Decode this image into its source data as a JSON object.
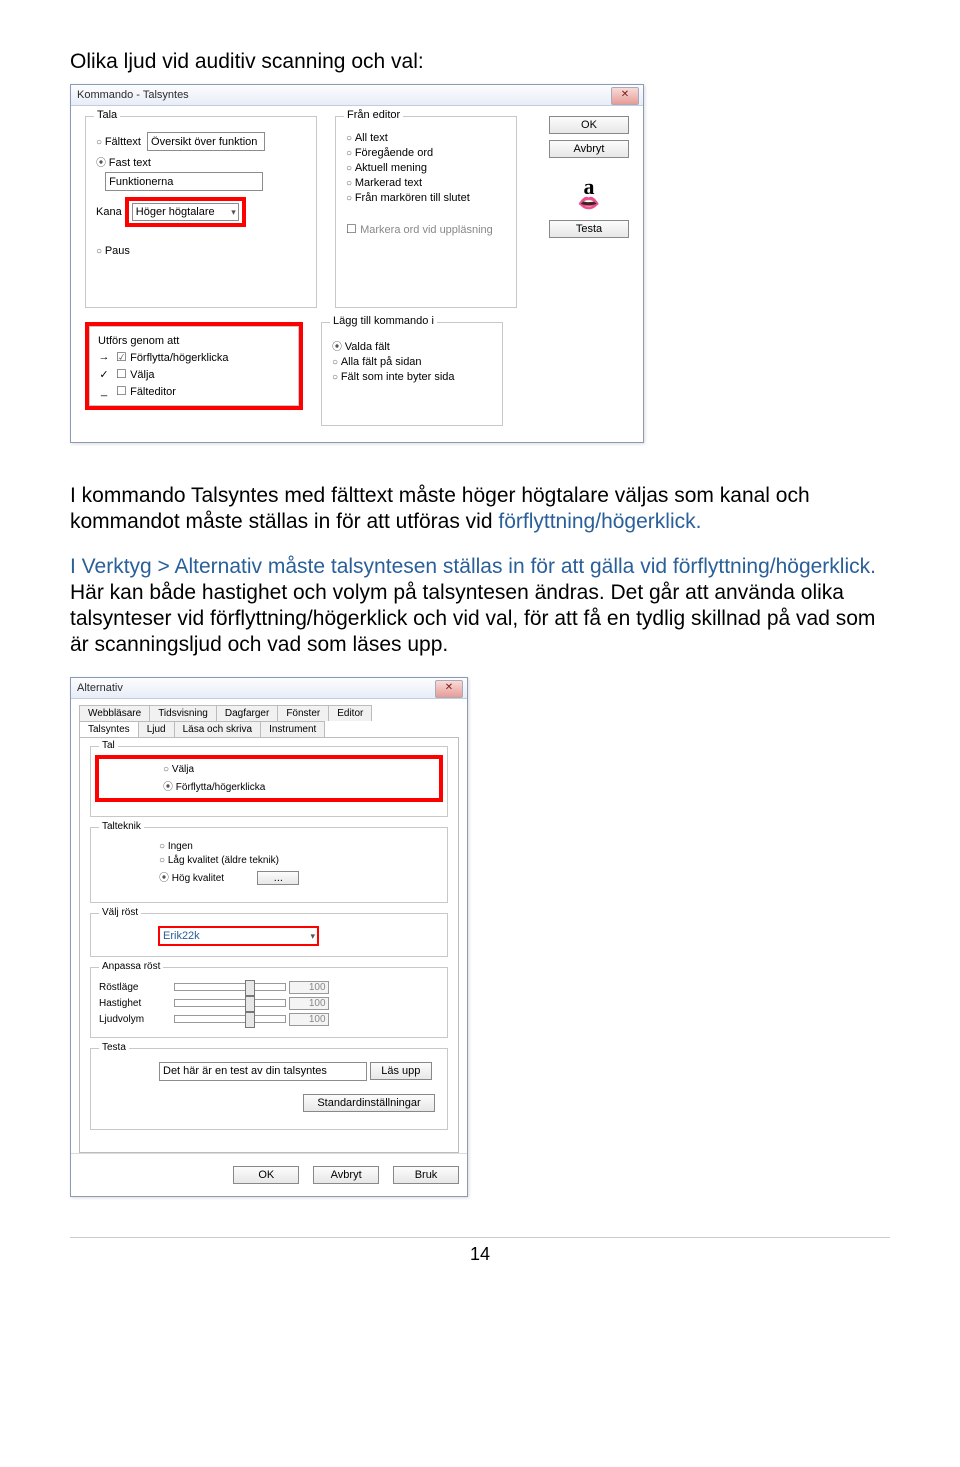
{
  "heading": "Olika ljud vid auditiv scanning och val:",
  "dlg1": {
    "title": "Kommando - Talsyntes",
    "ok": "OK",
    "avbryt": "Avbryt",
    "testa": "Testa",
    "tala": {
      "legend": "Tala",
      "falttext": "Fälttext",
      "oversikt": "Översikt över funktion",
      "fast": "Fast text",
      "funktionerna": "Funktionerna",
      "kanal_lbl": "Kana",
      "kanal_val": "Höger högtalare",
      "paus": "Paus"
    },
    "editor": {
      "legend": "Från editor",
      "all": "All text",
      "foreg": "Föregående ord",
      "aktuell": "Aktuell mening",
      "markerad": "Markerad text",
      "slutet": "Från markören till slutet",
      "markera_ord": "Markera ord vid uppläsning"
    },
    "utfors": {
      "legend": "Utförs genom att",
      "forflytta": "Förflytta/högerklicka",
      "valja": "Välja",
      "falteditor": "Fälteditor"
    },
    "lagg": {
      "legend": "Lägg till kommando i",
      "valda": "Valda fält",
      "alla": "Alla fält på sidan",
      "inte": "Fält som inte byter sida"
    }
  },
  "para1a": "I kommando Talsyntes med fälttext måste höger högtalare väljas som kanal och kommandot måste ställas in för att utföras vid ",
  "para1b": "förflyttning/högerklick.",
  "para2a": "I Verktyg > Alternativ måste talsyntesen ställas in för att gälla vid förflyttning/högerklick.",
  "para2b": " Här kan både hastighet och volym på talsyntesen ändras. Det går att använda olika talsynteser vid förflyttning/högerklick och vid val, för att få en tydlig skillnad på vad som är scanningsljud och vad som läses upp.",
  "dlg2": {
    "title": "Alternativ",
    "tabs_row1": [
      "Webbläsare",
      "Tidsvisning",
      "Dagfarger",
      "Fönster",
      "Editor"
    ],
    "tabs_row2": [
      "Talsyntes",
      "Ljud",
      "Läsa och skriva",
      "Instrument"
    ],
    "tal": {
      "legend": "Tal",
      "valja": "Välja",
      "forflytta": "Förflytta/högerklicka"
    },
    "talteknik": {
      "legend": "Talteknik",
      "ingen": "Ingen",
      "lag": "Låg kvalitet (äldre teknik)",
      "hog": "Hög kvalitet",
      "more": "..."
    },
    "valj_rost": {
      "legend": "Välj röst",
      "voice": "Erik22k"
    },
    "anpassa": {
      "legend": "Anpassa röst",
      "rostlage": "Röstläge",
      "hastighet": "Hastighet",
      "volym": "Ljudvolym",
      "val": "100"
    },
    "testa": {
      "legend": "Testa",
      "text": "Det här är en test av din talsyntes",
      "las": "Läs upp",
      "std": "Standardinställningar"
    },
    "ok": "OK",
    "avbryt": "Avbryt",
    "bruk": "Bruk"
  },
  "page_no": "14"
}
